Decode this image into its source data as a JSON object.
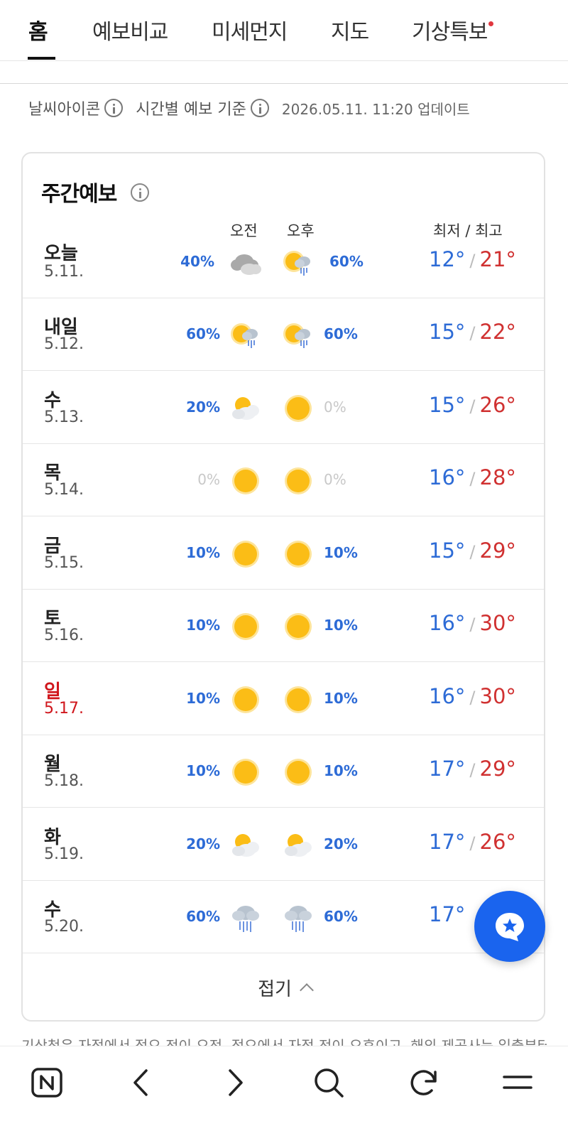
{
  "tabs": [
    {
      "label": "홈",
      "active": true
    },
    {
      "label": "예보비교",
      "active": false
    },
    {
      "label": "미세먼지",
      "active": false
    },
    {
      "label": "지도",
      "active": false
    },
    {
      "label": "기상특보",
      "active": false,
      "alert_dot": true
    }
  ],
  "info": {
    "icon_label": "날씨아이콘",
    "basis_label": "시간별 예보 기준",
    "updated": "2026.05.11. 11:20 업데이트"
  },
  "weekly": {
    "title": "주간예보",
    "col_am": "오전",
    "col_pm": "오후",
    "col_temp": "최저 / 최고",
    "rows": [
      {
        "day": "오늘",
        "date": "5.11.",
        "am_pct": "40%",
        "am_icon": "cloudy-icon",
        "pm_icon": "sun-cloud-rain-icon",
        "pm_pct": "60%",
        "min": "12°",
        "max": "21°",
        "red": false
      },
      {
        "day": "내일",
        "date": "5.12.",
        "am_pct": "60%",
        "am_icon": "sun-cloud-rain-icon",
        "pm_icon": "sun-cloud-rain-icon",
        "pm_pct": "60%",
        "min": "15°",
        "max": "22°",
        "red": false
      },
      {
        "day": "수",
        "date": "5.13.",
        "am_pct": "20%",
        "am_icon": "partly-cloudy-icon",
        "pm_icon": "sun-icon",
        "pm_pct": "0%",
        "min": "15°",
        "max": "26°",
        "red": false
      },
      {
        "day": "목",
        "date": "5.14.",
        "am_pct": "0%",
        "am_icon": "sun-icon",
        "pm_icon": "sun-icon",
        "pm_pct": "0%",
        "min": "16°",
        "max": "28°",
        "red": false
      },
      {
        "day": "금",
        "date": "5.15.",
        "am_pct": "10%",
        "am_icon": "sun-icon",
        "pm_icon": "sun-icon",
        "pm_pct": "10%",
        "min": "15°",
        "max": "29°",
        "red": false
      },
      {
        "day": "토",
        "date": "5.16.",
        "am_pct": "10%",
        "am_icon": "sun-icon",
        "pm_icon": "sun-icon",
        "pm_pct": "10%",
        "min": "16°",
        "max": "30°",
        "red": false
      },
      {
        "day": "일",
        "date": "5.17.",
        "am_pct": "10%",
        "am_icon": "sun-icon",
        "pm_icon": "sun-icon",
        "pm_pct": "10%",
        "min": "16°",
        "max": "30°",
        "red": true
      },
      {
        "day": "월",
        "date": "5.18.",
        "am_pct": "10%",
        "am_icon": "sun-icon",
        "pm_icon": "sun-icon",
        "pm_pct": "10%",
        "min": "17°",
        "max": "29°",
        "red": false
      },
      {
        "day": "화",
        "date": "5.19.",
        "am_pct": "20%",
        "am_icon": "partly-cloudy-icon",
        "pm_icon": "partly-cloudy-icon",
        "pm_pct": "20%",
        "min": "17°",
        "max": "26°",
        "red": false
      },
      {
        "day": "수",
        "date": "5.20.",
        "am_pct": "60%",
        "am_icon": "rain-icon",
        "pm_icon": "rain-icon",
        "pm_pct": "60%",
        "min": "17°",
        "max": "",
        "red": false
      }
    ],
    "fold_label": "접기"
  },
  "footnote": "기상청은 자정에서 정오 전이 오전, 정오에서 자정 전이 오후이고, 해외 제공사는 일출부터",
  "colors": {
    "accent": "#2d6bd6",
    "hot": "#d03131",
    "sunday": "#d0161c",
    "fab": "#1a64ee"
  },
  "bottom_nav": [
    "naver-home-icon",
    "back-icon",
    "forward-icon",
    "search-icon",
    "refresh-icon",
    "menu-icon"
  ]
}
